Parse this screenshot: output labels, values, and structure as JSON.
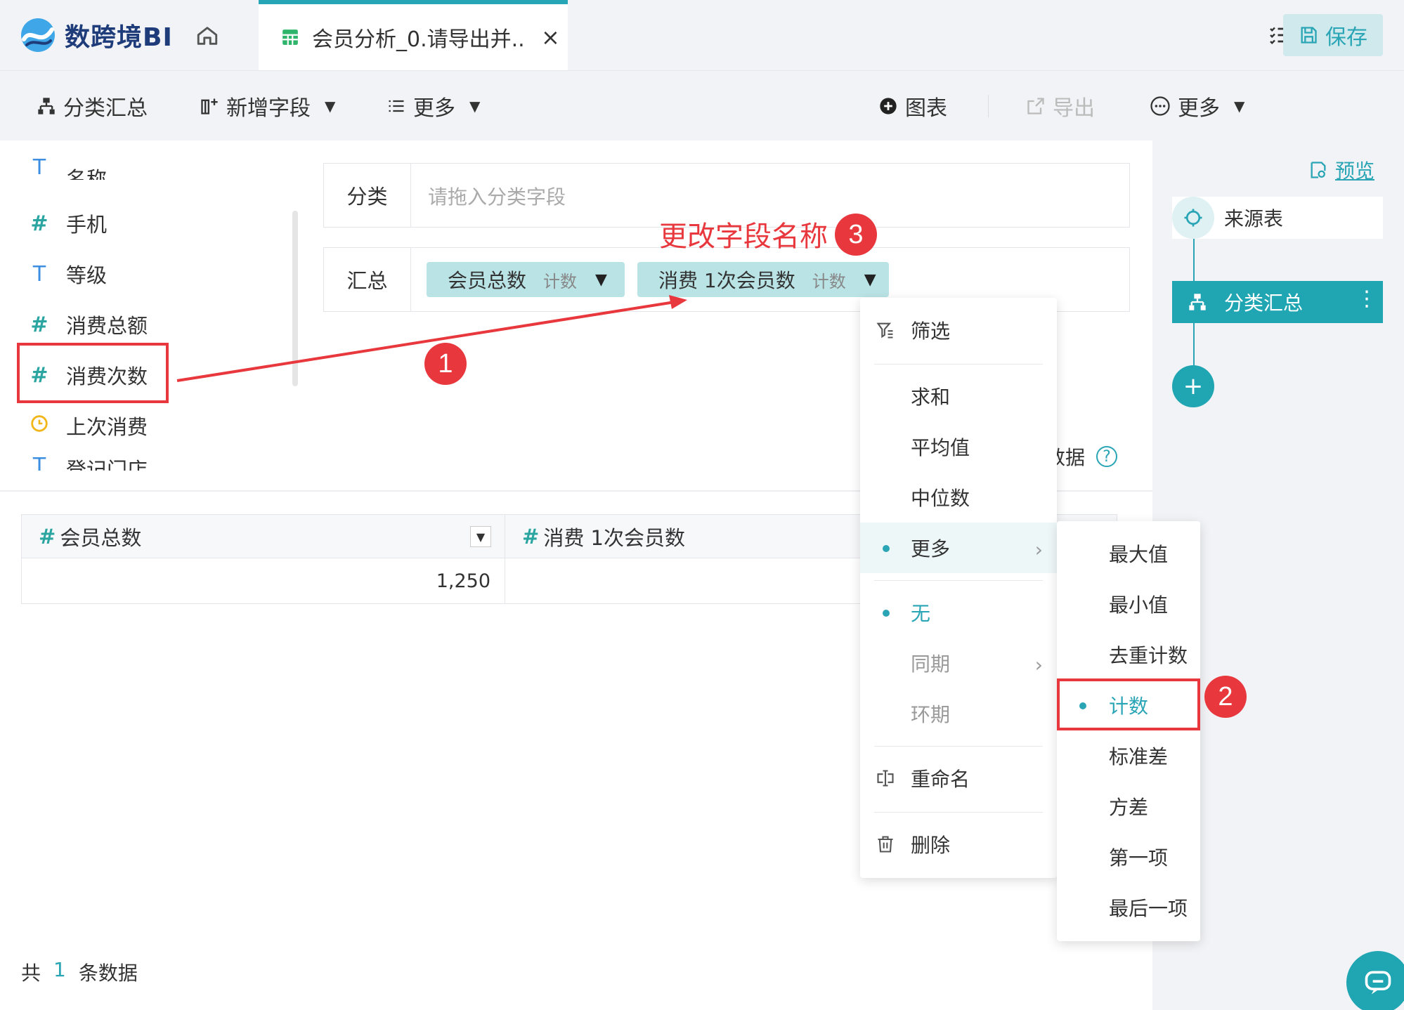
{
  "app": {
    "logo_text": "数跨境BI"
  },
  "tab": {
    "title": "会员分析_0.请导出并...",
    "close": "×"
  },
  "toolbar": {
    "group_summary": "分类汇总",
    "add_field": "新增字段",
    "more_left": "更多",
    "chart": "图表",
    "export": "导出",
    "more_right": "更多",
    "save": "保存"
  },
  "fields": {
    "partial_top": "名称",
    "items": [
      {
        "type": "#",
        "label": "手机"
      },
      {
        "type": "T",
        "label": "等级"
      },
      {
        "type": "#",
        "label": "消费总额"
      },
      {
        "type": "#",
        "label": "消费次数"
      },
      {
        "type": "clock",
        "label": "上次消费"
      }
    ],
    "partial_bottom": "登记门店"
  },
  "config": {
    "classify_label": "分类",
    "classify_placeholder": "请拖入分类字段",
    "summary_label": "汇总",
    "chips": [
      {
        "name": "会员总数",
        "agg": "计数"
      },
      {
        "name": "消费 1次会员数",
        "agg": "计数"
      }
    ]
  },
  "hint": {
    "text": "数据"
  },
  "annotations": {
    "one": "1",
    "two": "2",
    "three": "3",
    "three_text": "更改字段名称"
  },
  "table": {
    "columns": [
      {
        "icon": "#",
        "name": "会员总数"
      },
      {
        "icon": "#",
        "name": "消费 1次会员数"
      }
    ],
    "rows": [
      [
        "1,250",
        ""
      ]
    ]
  },
  "footer": {
    "prefix": "共",
    "count": "1",
    "suffix": "条数据"
  },
  "flow": {
    "preview": "预览",
    "source_node": "来源表",
    "agg_node": "分类汇总",
    "agg_menu": "⋮",
    "add": "+"
  },
  "menu1": {
    "filter": "筛选",
    "sum": "求和",
    "avg": "平均值",
    "median": "中位数",
    "more": "更多",
    "none": "无",
    "yoy": "同期",
    "mom": "环期",
    "rename": "重命名",
    "delete": "删除"
  },
  "menu2": {
    "items": [
      "最大值",
      "最小值",
      "去重计数",
      "计数",
      "标准差",
      "方差",
      "第一项",
      "最后一项"
    ],
    "selected_index": 3
  },
  "colors": {
    "accent": "#2aa5b5",
    "annotation": "#e8383d",
    "chip_bg": "#b9e3e5"
  }
}
